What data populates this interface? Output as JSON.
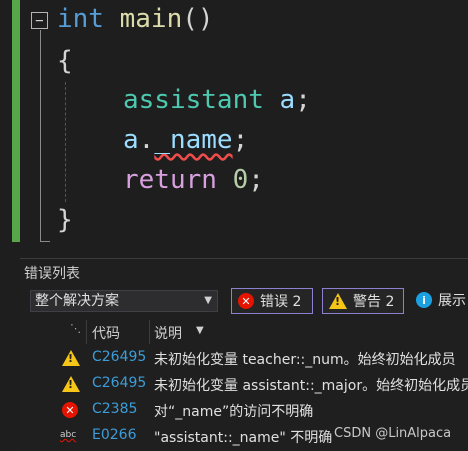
{
  "editor": {
    "fold_symbol": "−",
    "line1": {
      "kw": "int",
      "fn": "main",
      "punct": "()"
    },
    "line2": "{",
    "line3": {
      "type": "assistant",
      "var": "a",
      "punct": ";"
    },
    "line4": {
      "var": "a",
      "dot": ".",
      "member": "_name",
      "punct": ";"
    },
    "line5": {
      "kw": "return",
      "num": "0",
      "punct": ";"
    },
    "line6": "}"
  },
  "error_list": {
    "title": "错误列表",
    "scope": "整个解决方案",
    "errors_label": "错误 2",
    "warnings_label": "警告 2",
    "messages_label": "展示",
    "columns": {
      "code": "代码",
      "description": "说明"
    },
    "rows": [
      {
        "icon": "warning-icon",
        "code": "C26495",
        "description": "未初始化变量 teacher::_num。始终初始化成员"
      },
      {
        "icon": "warning-icon",
        "code": "C26495",
        "description": "未初始化变量 assistant::_major。始终初始化成员"
      },
      {
        "icon": "error-icon",
        "code": "C2385",
        "description": "对“_name”的访问不明确"
      },
      {
        "icon": "intellisense-icon",
        "code": "E0266",
        "description": "\"assistant::_name\" 不明确"
      }
    ]
  },
  "watermark": "CSDN @LinAlpaca",
  "colors": {
    "accent": "#8f7fd1",
    "error": "#e51400",
    "warning": "#f5c518",
    "code_link": "#3c9dd8",
    "changed_bar": "#57a64a"
  }
}
